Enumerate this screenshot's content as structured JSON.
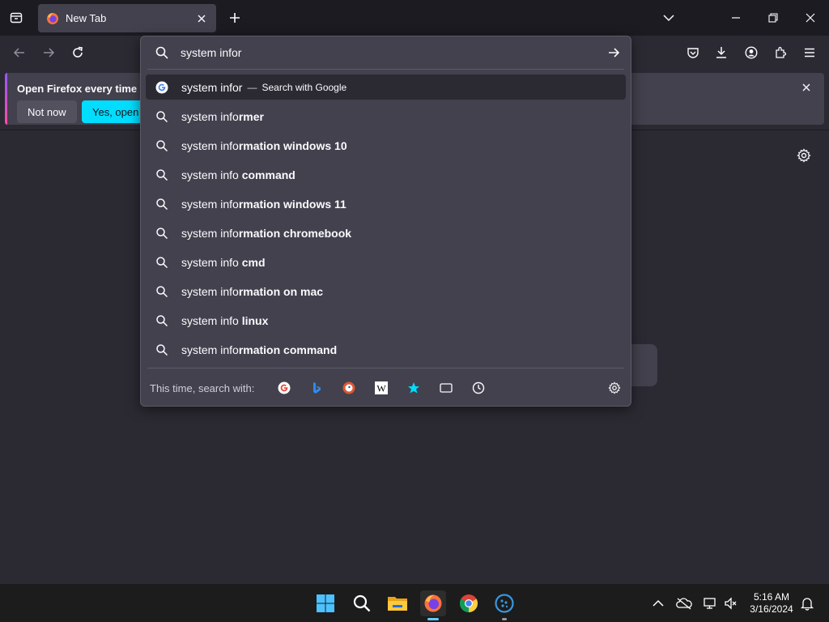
{
  "browser": {
    "tab": {
      "title": "New Tab",
      "favicon": "firefox-icon"
    },
    "window_controls": [
      "list-all-tabs",
      "minimize",
      "restore",
      "close"
    ]
  },
  "notification": {
    "message": "Open Firefox every time yo",
    "secondary_label": "Not now",
    "primary_label": "Yes, open F"
  },
  "urlbar": {
    "value": "system infor",
    "first_result": {
      "text": "system infor",
      "dash": "—",
      "action": "Search with Google"
    },
    "suggestions": [
      {
        "typed": "system info",
        "bold": "rmer"
      },
      {
        "typed": "system info",
        "bold": "rmation windows 10"
      },
      {
        "typed": "system info ",
        "bold": "command"
      },
      {
        "typed": "system info",
        "bold": "rmation windows 11"
      },
      {
        "typed": "system info",
        "bold": "rmation chromebook"
      },
      {
        "typed": "system info ",
        "bold": "cmd"
      },
      {
        "typed": "system info",
        "bold": "rmation on mac"
      },
      {
        "typed": "system info ",
        "bold": "linux"
      },
      {
        "typed": "system info",
        "bold": "rmation command"
      }
    ],
    "oneoff_label": "This time, search with:",
    "oneoff_engines": [
      "google-icon",
      "bing-icon",
      "duckduckgo-icon",
      "wikipedia-icon",
      "bookmarks-icon",
      "tabs-icon",
      "history-icon",
      "settings-icon"
    ]
  },
  "taskbar": {
    "time": "5:16 AM",
    "date": "3/16/2024",
    "apps": [
      "windows-start-icon",
      "search-icon",
      "file-explorer-icon",
      "firefox-icon",
      "chrome-icon",
      "app-icon"
    ]
  },
  "colors": {
    "accent": "#00ddff",
    "panel": "#42414d",
    "background": "#2b2a33",
    "tabstrip": "#1c1b22"
  }
}
